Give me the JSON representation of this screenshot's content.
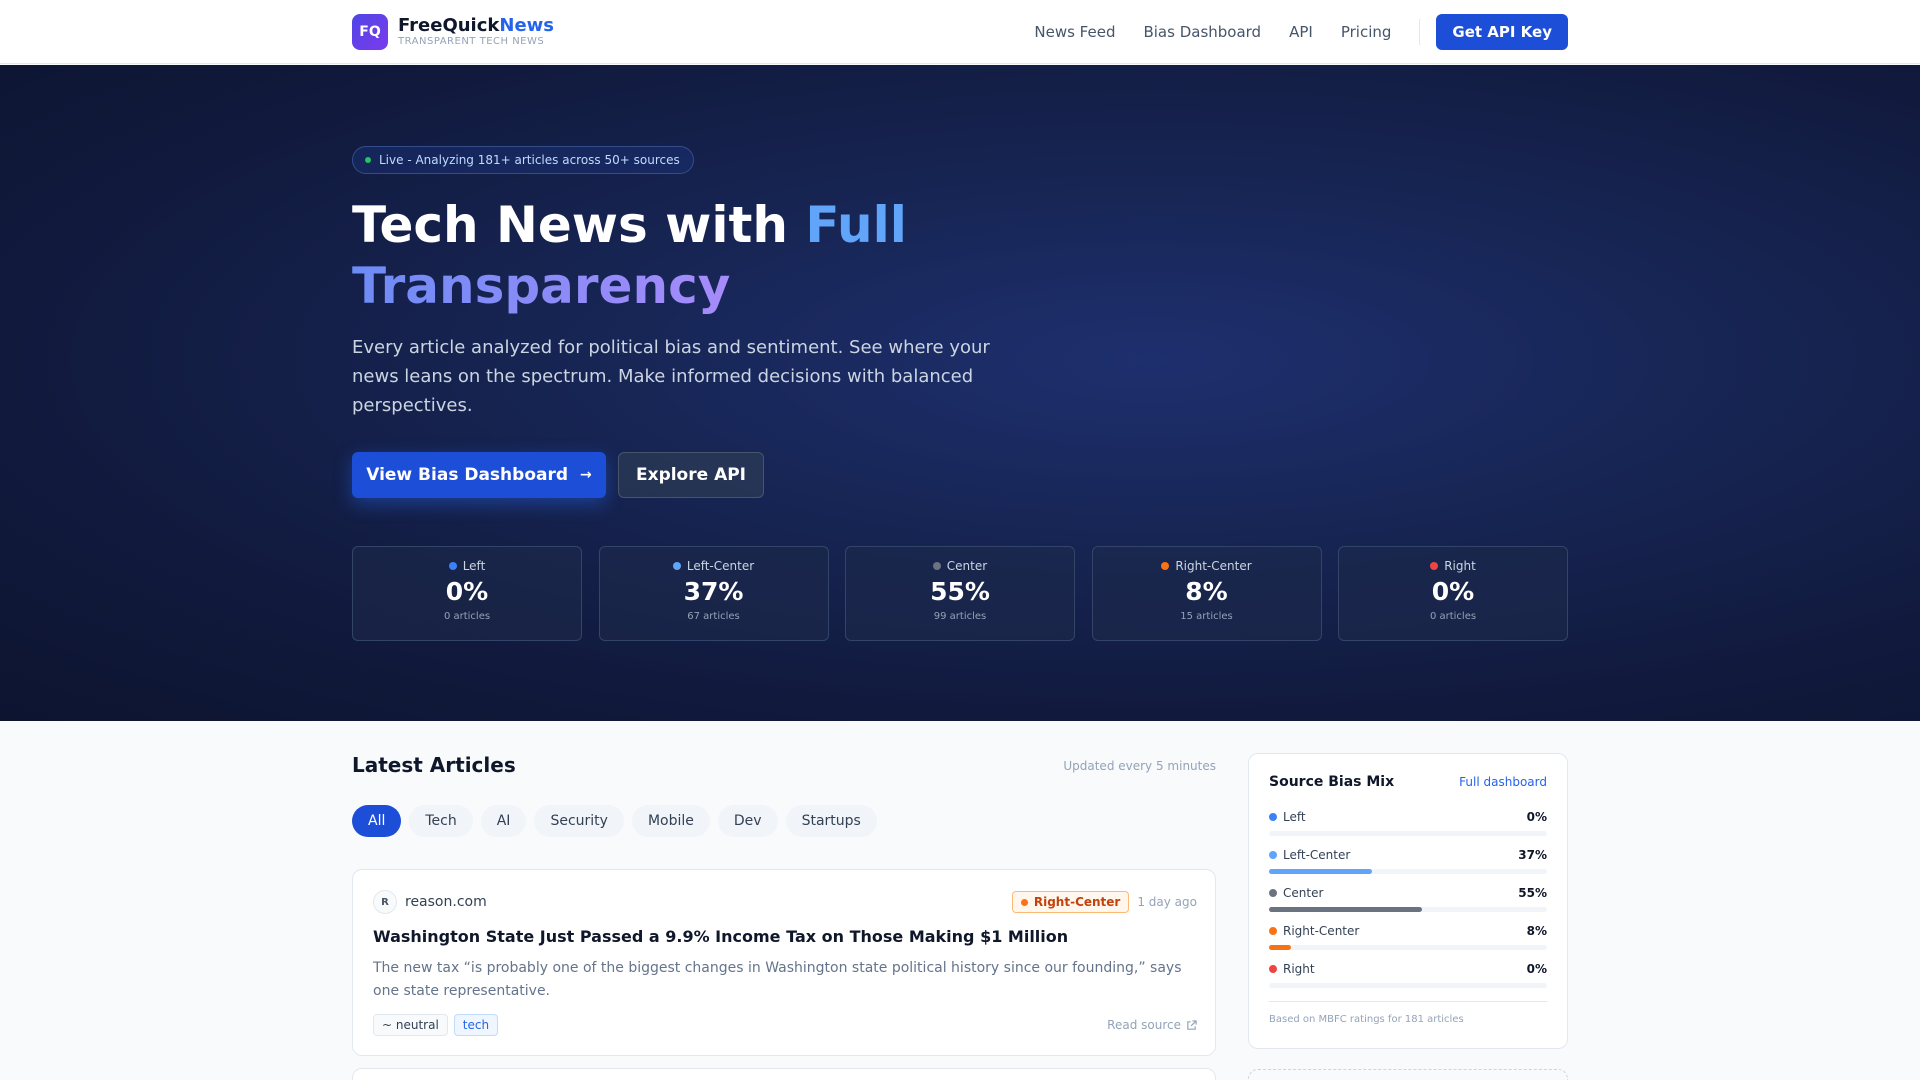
{
  "nav": {
    "logo": "FQ",
    "brand_main": "FreeQuick",
    "brand_accent": "News",
    "tagline": "TRANSPARENT TECH NEWS",
    "links": [
      "News Feed",
      "Bias Dashboard",
      "API",
      "Pricing"
    ],
    "cta": "Get API Key"
  },
  "hero": {
    "live_text": "Live - Analyzing 181+ articles across 50+ sources",
    "title_part1": "Tech News with ",
    "title_full": "Full",
    "title_trans": "Transparency",
    "subtitle": "Every article analyzed for political bias and sentiment. See where your news leans on the spectrum. Make informed decisions with balanced perspectives.",
    "primary_button": "View Bias Dashboard",
    "primary_arrow": "→",
    "secondary_button": "Explore API",
    "stats": [
      {
        "label": "Left",
        "value": "0%",
        "count": "0 articles",
        "color": "#3b82f6"
      },
      {
        "label": "Left-Center",
        "value": "37%",
        "count": "67 articles",
        "color": "#60a5fa"
      },
      {
        "label": "Center",
        "value": "55%",
        "count": "99 articles",
        "color": "#6b7280"
      },
      {
        "label": "Right-Center",
        "value": "8%",
        "count": "15 articles",
        "color": "#f97316"
      },
      {
        "label": "Right",
        "value": "0%",
        "count": "0 articles",
        "color": "#ef4444"
      }
    ]
  },
  "articles": {
    "section_title": "Latest Articles",
    "updated": "Updated every 5 minutes",
    "filters": [
      "All",
      "Tech",
      "AI",
      "Security",
      "Mobile",
      "Dev",
      "Startups"
    ],
    "active_filter": "All",
    "items": [
      {
        "source_initial": "R",
        "source": "reason.com",
        "bias": "Right-Center",
        "bias_color": "#f97316",
        "time": "1 day ago",
        "title": "Washington State Just Passed a 9.9% Income Tax on Those Making $1 Million",
        "description": "The new tax “is probably one of the biggest changes in Washington state political history since our founding,” says one state representative.",
        "sentiment": "~ neutral",
        "category": "tech",
        "read_source": "Read source"
      }
    ]
  },
  "sidebar": {
    "title": "Source Bias Mix",
    "link": "Full dashboard",
    "rows": [
      {
        "label": "Left",
        "pct": "0%",
        "fraction": 0.0,
        "color": "#3b82f6"
      },
      {
        "label": "Left-Center",
        "pct": "37%",
        "fraction": 0.37,
        "color": "#60a5fa"
      },
      {
        "label": "Center",
        "pct": "55%",
        "fraction": 0.55,
        "color": "#6b7280"
      },
      {
        "label": "Right-Center",
        "pct": "8%",
        "fraction": 0.08,
        "color": "#f97316"
      },
      {
        "label": "Right",
        "pct": "0%",
        "fraction": 0.0,
        "color": "#ef4444"
      }
    ],
    "footnote": "Based on MBFC ratings for 181 articles"
  }
}
